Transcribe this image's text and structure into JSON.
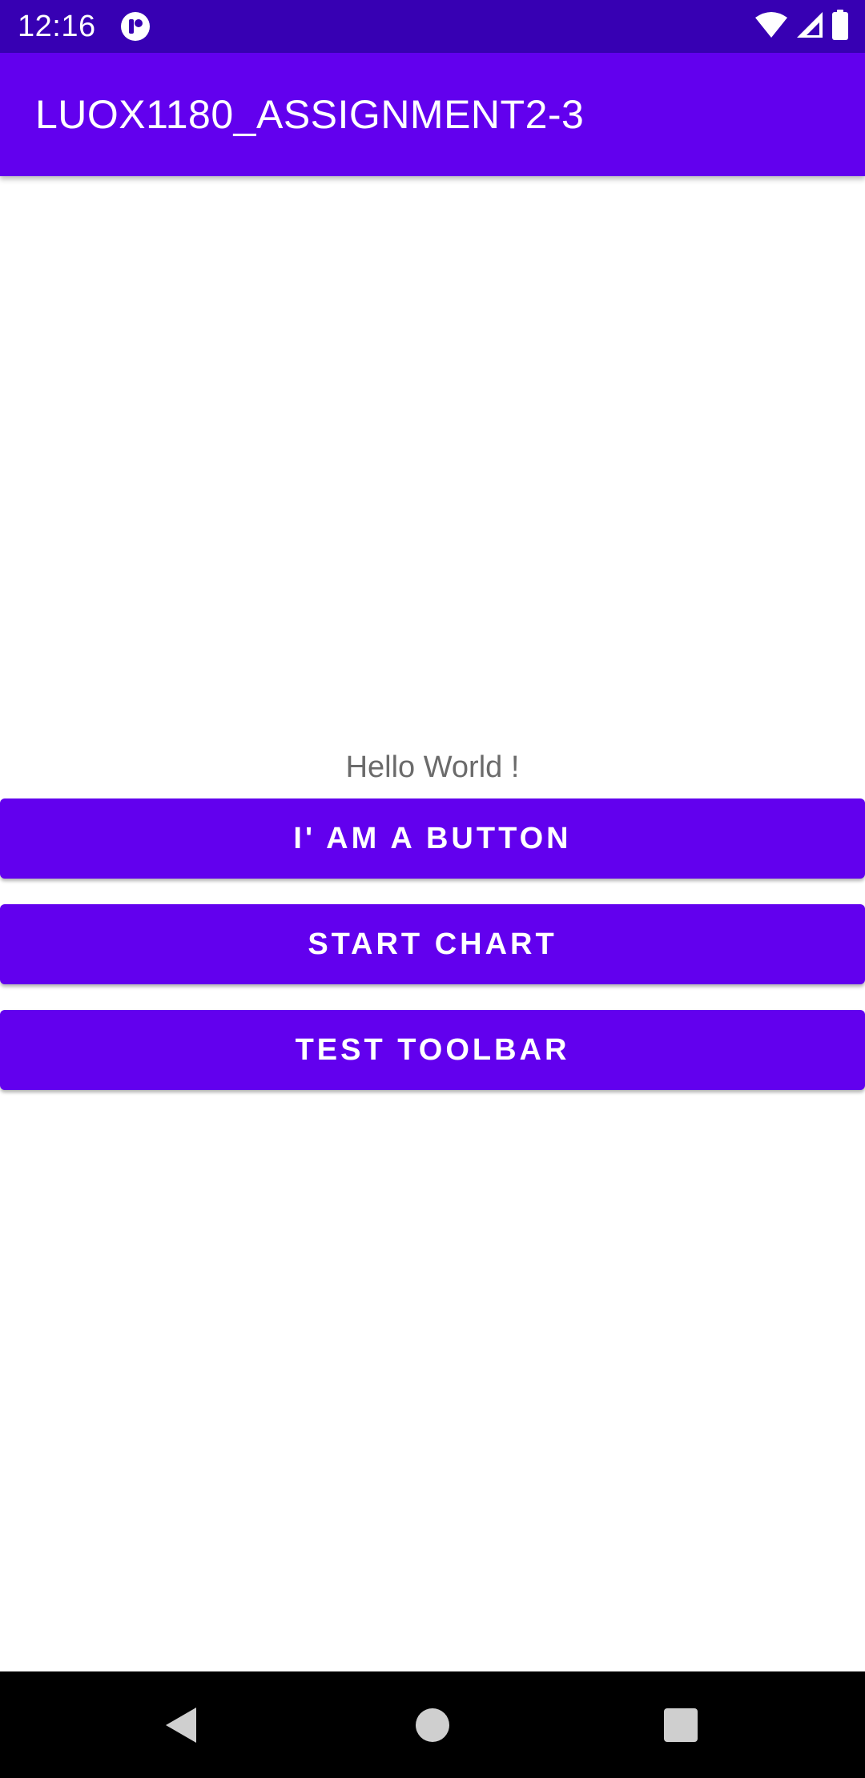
{
  "status_bar": {
    "time": "12:16",
    "icons": [
      "app-notification-icon",
      "wifi-icon",
      "signal-icon",
      "battery-icon"
    ],
    "background": "#3700B3"
  },
  "app_bar": {
    "title": "LUOX1180_ASSIGNMENT2-3",
    "background": "#6200EE"
  },
  "main": {
    "hello_text": "Hello World !",
    "buttons": [
      {
        "label": "I' AM A BUTTON"
      },
      {
        "label": "START CHART"
      },
      {
        "label": "TEST TOOLBAR"
      }
    ],
    "button_color": "#6200EE"
  },
  "nav_bar": {
    "icons": [
      "back-icon",
      "home-icon",
      "recents-icon"
    ]
  }
}
